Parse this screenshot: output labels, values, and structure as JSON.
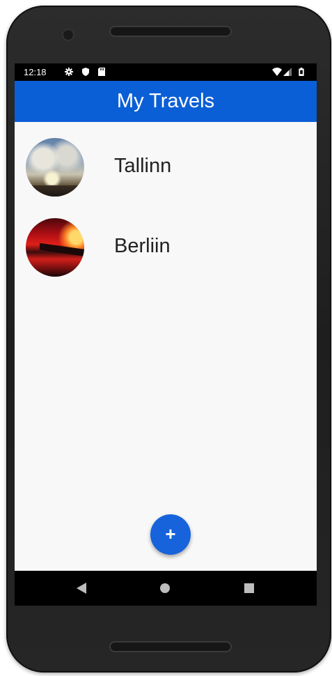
{
  "status_bar": {
    "time": "12:18",
    "left_icons": [
      "gear-icon",
      "shield-icon",
      "sd-card-icon"
    ],
    "right_icons": [
      "wifi-icon",
      "signal-icon",
      "battery-icon"
    ]
  },
  "app_bar": {
    "title": "My Travels",
    "color": "#0b5fd6"
  },
  "travels": [
    {
      "label": "Tallinn",
      "thumbnail": "sunlit-clouds-photo"
    },
    {
      "label": "Berliin",
      "thumbnail": "red-sunset-photo"
    }
  ],
  "fab": {
    "label": "+",
    "icon": "plus-icon",
    "color": "#1663dc"
  },
  "nav_bar": {
    "buttons": [
      "back-icon",
      "home-icon",
      "recents-icon"
    ]
  }
}
